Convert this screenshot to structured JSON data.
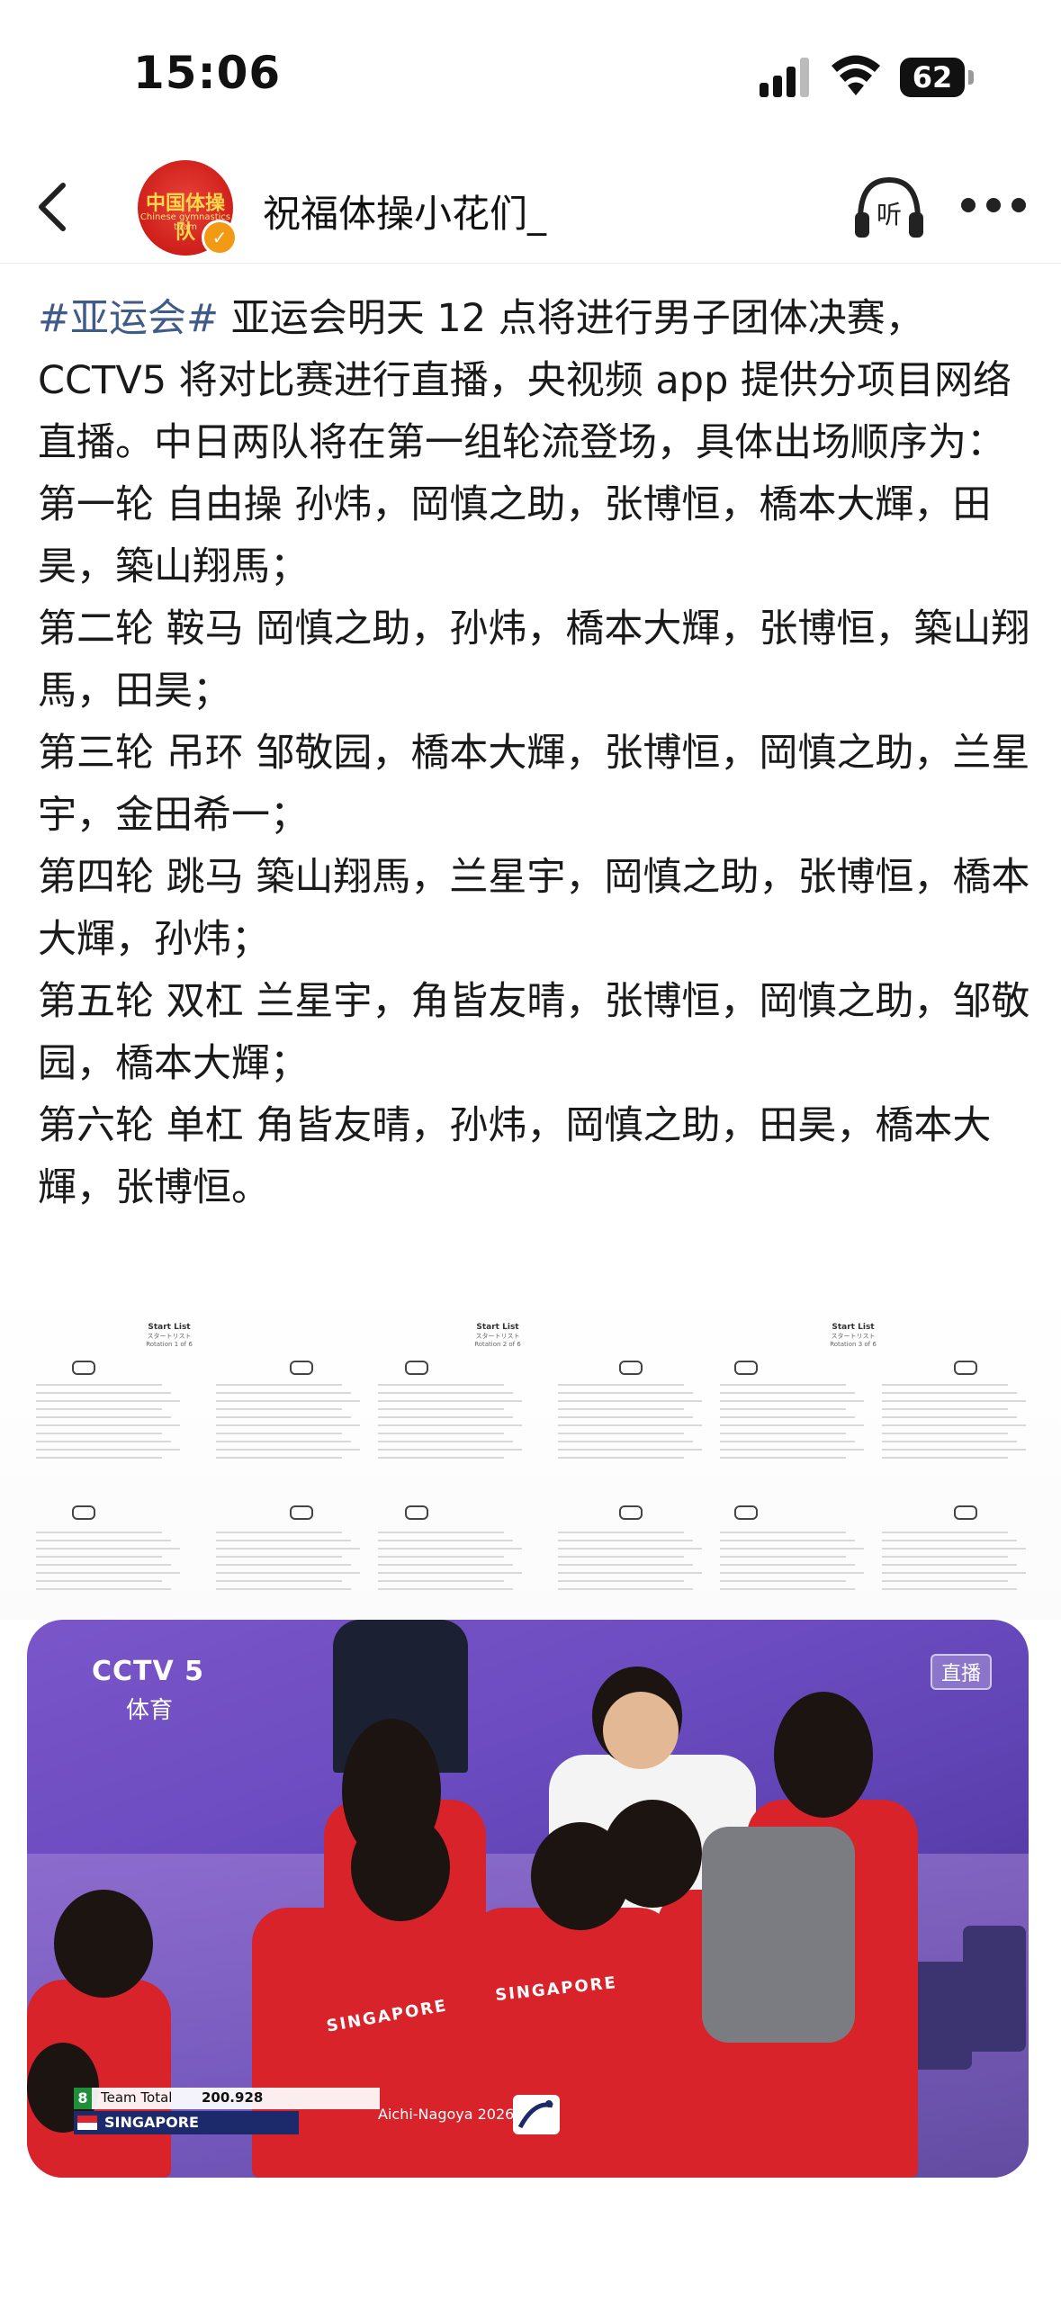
{
  "status_bar": {
    "time": "15:06",
    "battery": "62"
  },
  "header": {
    "author": "祝福体操小花们_",
    "listen_label": "听",
    "avatar_text": "中国体操队",
    "avatar_subtext": "Chinese gymnastics team"
  },
  "post": {
    "hashtag": "#亚运会#",
    "paragraphs": [
      " 亚运会明天 12 点将进行男子团体决赛，CCTV5 将对比赛进行直播，央视频 app 提供分项目网络直播。中日两队将在第一组轮流登场，具体出场顺序为：",
      "第一轮 自由操 孙炜，岡慎之助，张博恒，橋本大輝，田昊，築山翔馬；",
      "第二轮 鞍马 岡慎之助，孙炜，橋本大輝，张博恒，築山翔馬，田昊；",
      "第三轮 吊环 邹敬园，橋本大輝，张博恒，岡慎之助，兰星宇，金田希一；",
      "第四轮 跳马 築山翔馬，兰星宇，岡慎之助，张博恒，橋本大輝，孙炜；",
      "第五轮 双杠 兰星宇，角皆友晴，张博恒，岡慎之助，邹敬园，橋本大輝；",
      "第六轮 单杠 角皆友晴，孙炜，岡慎之助，田昊，橋本大輝，张博恒。"
    ]
  },
  "start_lists": [
    {
      "title": "Start List",
      "subtitle": "スタートリスト",
      "rotation": "Rotation 1 of 6"
    },
    {
      "title": "Start List",
      "subtitle": "スタートリスト",
      "rotation": "Rotation 2 of 6"
    },
    {
      "title": "Start List",
      "subtitle": "スタートリスト",
      "rotation": "Rotation 3 of 6"
    }
  ],
  "video": {
    "channel": "CCTV 5",
    "channel_sub": "体育",
    "live_badge": "直播",
    "jersey_text": "SINGAPORE",
    "score_rank": "8",
    "score_label": "Team Total",
    "score_value": "200.928",
    "score_country": "SINGAPORE",
    "event_name": "Aichi-Nagoya 2026"
  }
}
